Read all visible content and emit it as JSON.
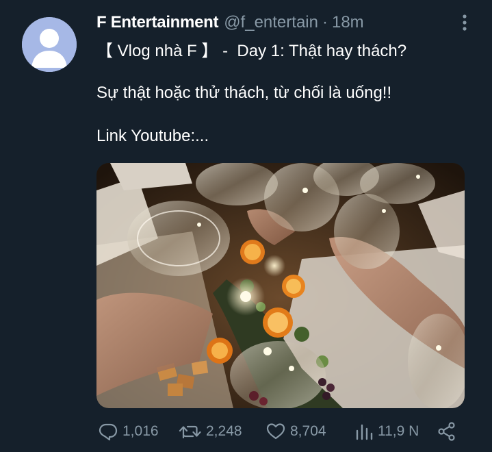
{
  "tweet": {
    "author_name": "F Entertainment",
    "handle": "@f_entertain",
    "separator": "·",
    "time": "18m",
    "lines": [
      "【 Vlog nhà F 】 -  Day 1: Thật hay thách?",
      "Sự thật hoặc thử thách, từ chối là uống!!",
      "Link Youtube:..."
    ],
    "media_icon": "photo-toasting-glasses"
  },
  "actions": {
    "replies": "1,016",
    "retweets": "2,248",
    "likes": "8,704",
    "views": "11,9 N",
    "reply_icon": "reply-icon",
    "retweet_icon": "retweet-icon",
    "like_icon": "heart-icon",
    "views_icon": "views-icon",
    "share_icon": "share-icon"
  },
  "colors": {
    "background": "#15202b",
    "text": "#ffffff",
    "secondary": "#8899a6",
    "avatar_bg": "#a6b8e6"
  }
}
